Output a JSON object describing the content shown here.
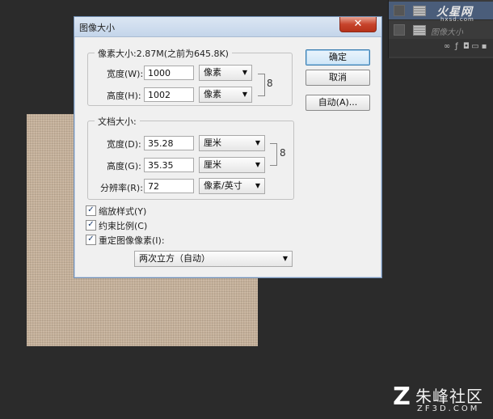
{
  "dialog": {
    "title": "图像大小",
    "close_label": "✕",
    "pixel_dimensions": {
      "label": "像素大小:2.87M(之前为645.8K)",
      "width_label": "宽度(W):",
      "width_value": "1000",
      "width_unit": "像素",
      "height_label": "高度(H):",
      "height_value": "1002",
      "height_unit": "像素"
    },
    "document_size": {
      "label": "文档大小:",
      "width_label": "宽度(D):",
      "width_value": "35.28",
      "width_unit": "厘米",
      "height_label": "高度(G):",
      "height_value": "35.35",
      "height_unit": "厘米",
      "resolution_label": "分辨率(R):",
      "resolution_value": "72",
      "resolution_unit": "像素/英寸"
    },
    "buttons": {
      "ok": "确定",
      "cancel": "取消",
      "auto": "自动(A)..."
    },
    "options": {
      "scale_styles": {
        "label": "缩放样式(Y)",
        "checked": true
      },
      "constrain": {
        "label": "约束比例(C)",
        "checked": true
      },
      "resample": {
        "label": "重定图像像素(I):",
        "checked": true
      },
      "resample_method": "两次立方（自动）"
    }
  },
  "layers_panel": {
    "layer_name": "图像大小",
    "icons": [
      "link-icon",
      "fx-icon",
      "mask-icon",
      "adjust-icon",
      "folder-icon",
      "new-layer-icon",
      "trash-icon"
    ]
  },
  "watermark_top": {
    "name": "火星网",
    "url": "hxsd.com"
  },
  "watermark_bottom": {
    "name": "朱峰社区",
    "url": "ZF3D.COM"
  }
}
